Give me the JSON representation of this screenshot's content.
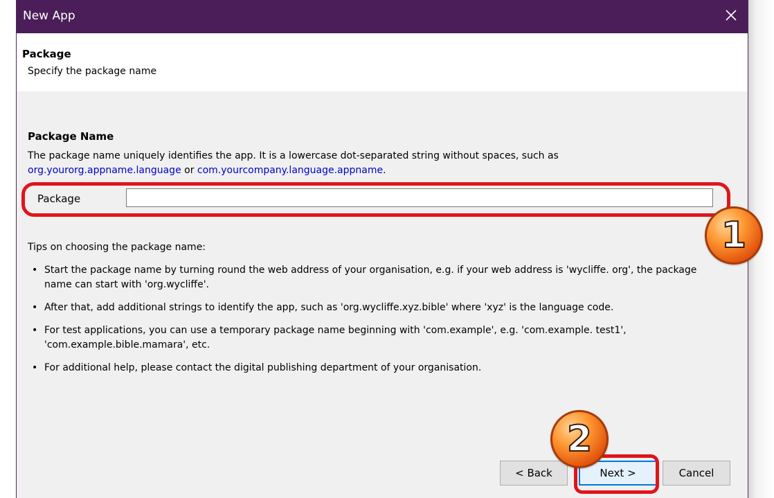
{
  "window": {
    "title": "New App",
    "close_icon": "close-icon"
  },
  "header": {
    "title": "Package",
    "subtitle": "Specify the package name"
  },
  "section": {
    "title": "Package Name",
    "desc_text": "The package name uniquely identifies the app. It is a lowercase dot-separated string without spaces, such as",
    "example1": "org.yourorg.appname.language",
    "or_text": "or",
    "example2": "com.yourcompany.language.appname",
    "period": "."
  },
  "package_field": {
    "label": "Package",
    "value": "",
    "placeholder": ""
  },
  "tips": {
    "title": "Tips on choosing the package name:",
    "items": [
      "Start the package name by turning round the web address of your organisation, e.g. if your web address is 'wycliffe. org', the package name can start with 'org.wycliffe'.",
      "After that, add additional strings to identify the app, such as 'org.wycliffe.xyz.bible' where 'xyz' is the language code.",
      "For test applications, you can use a temporary package name beginning with 'com.example', e.g. 'com.example. test1', 'com.example.bible.mamara', etc.",
      "For additional help, please contact the digital publishing department of your organisation."
    ]
  },
  "buttons": {
    "back": "< Back",
    "next": "Next >",
    "cancel": "Cancel"
  },
  "annotations": {
    "badge1": "1",
    "badge2": "2",
    "highlight_color": "#e0141b",
    "badge_color": "#f07b1e"
  },
  "colors": {
    "titlebar": "#4b1e59",
    "link": "#0000c8",
    "dialog_bg": "#f0f0f0"
  }
}
